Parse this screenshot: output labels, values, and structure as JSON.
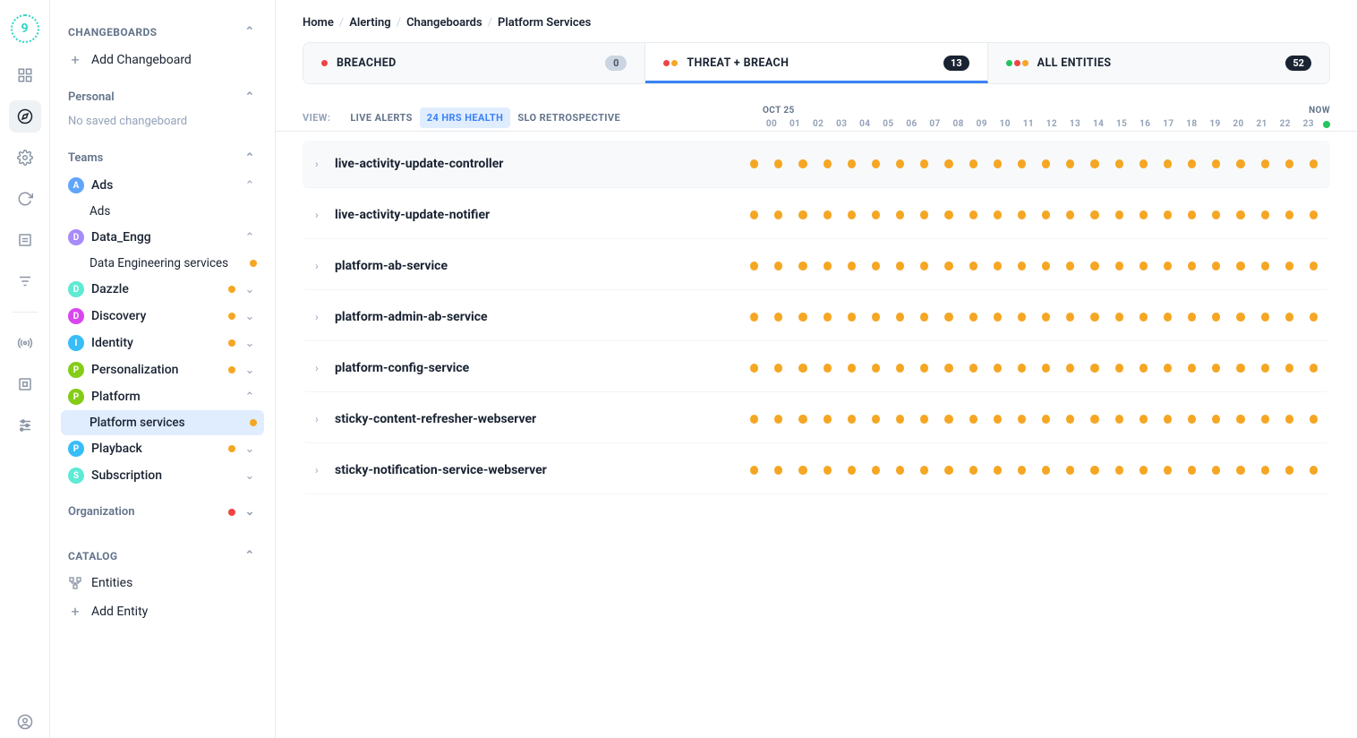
{
  "breadcrumb": [
    "Home",
    "Alerting",
    "Changeboards",
    "Platform Services"
  ],
  "sidebar": {
    "changeboards_label": "CHANGEBOARDS",
    "add_changeboard": "Add Changeboard",
    "personal_label": "Personal",
    "personal_empty": "No saved changeboard",
    "teams_label": "Teams",
    "teams": [
      {
        "letter": "A",
        "name": "Ads",
        "color": "#60a5fa",
        "expanded": true,
        "children": [
          {
            "name": "Ads",
            "dot": false
          }
        ]
      },
      {
        "letter": "D",
        "name": "Data_Engg",
        "color": "#a78bfa",
        "expanded": true,
        "children": [
          {
            "name": "Data Engineering services",
            "dot": true
          }
        ]
      },
      {
        "letter": "D",
        "name": "Dazzle",
        "color": "#5eead4",
        "dot": true,
        "collapsed": true
      },
      {
        "letter": "D",
        "name": "Discovery",
        "color": "#d946ef",
        "dot": true,
        "collapsed": true
      },
      {
        "letter": "I",
        "name": "Identity",
        "color": "#38bdf8",
        "dot": true,
        "collapsed": true
      },
      {
        "letter": "P",
        "name": "Personalization",
        "color": "#84cc16",
        "dot": true,
        "collapsed": true
      },
      {
        "letter": "P",
        "name": "Platform",
        "color": "#84cc16",
        "expanded": true,
        "children": [
          {
            "name": "Platform services",
            "dot": true,
            "selected": true
          }
        ]
      },
      {
        "letter": "P",
        "name": "Playback",
        "color": "#38bdf8",
        "dot": true,
        "collapsed": true
      },
      {
        "letter": "S",
        "name": "Subscription",
        "color": "#5eead4",
        "collapsed": true
      }
    ],
    "organization_label": "Organization",
    "catalog_label": "CATALOG",
    "entities_label": "Entities",
    "add_entity_label": "Add Entity"
  },
  "tabs": [
    {
      "id": "breached",
      "label": "BREACHED",
      "count": "0",
      "indicators": [
        "#ef4444"
      ]
    },
    {
      "id": "threat",
      "label": "THREAT + BREACH",
      "count": "13",
      "active": true,
      "indicators": [
        "#ef4444",
        "#f5a623"
      ]
    },
    {
      "id": "all",
      "label": "ALL ENTITIES",
      "count": "52",
      "indicators": [
        "#22c55e",
        "#ef4444",
        "#f5a623"
      ]
    }
  ],
  "view": {
    "label": "VIEW:",
    "options": [
      "LIVE ALERTS",
      "24 HRS HEALTH",
      "SLO RETROSPECTIVE"
    ],
    "active": "24 HRS HEALTH"
  },
  "timeline": {
    "date": "OCT 25",
    "now": "NOW",
    "hours": [
      "00",
      "01",
      "02",
      "03",
      "04",
      "05",
      "06",
      "07",
      "08",
      "09",
      "10",
      "11",
      "12",
      "13",
      "14",
      "15",
      "16",
      "17",
      "18",
      "19",
      "20",
      "21",
      "22",
      "23"
    ]
  },
  "services": [
    "live-activity-update-controller",
    "live-activity-update-notifier",
    "platform-ab-service",
    "platform-admin-ab-service",
    "platform-config-service",
    "sticky-content-refresher-webserver",
    "sticky-notification-service-webserver"
  ]
}
